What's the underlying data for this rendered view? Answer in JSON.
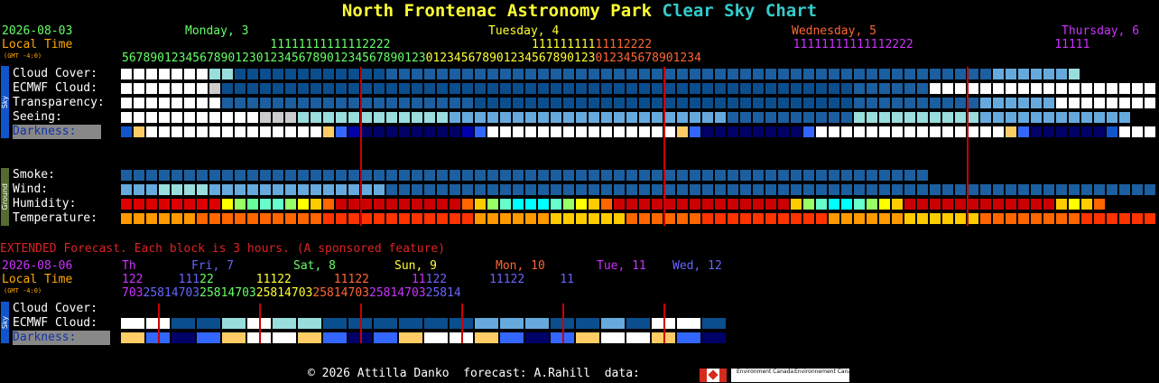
{
  "title": {
    "part1": "North Frontenac Astronomy Park",
    "part2": "Clear Sky Chart"
  },
  "header": {
    "date": "2026-08-03",
    "local_time": "Local Time",
    "gmt": "(GMT -4:0)",
    "days": [
      {
        "label": "Monday, 3",
        "color": "#66ff66"
      },
      {
        "label": "Tuesday, 4",
        "color": "#ffff33"
      },
      {
        "label": "Wednesday, 5",
        "color": "#ff6633"
      },
      {
        "label": "Thursday, 6",
        "color": "#cc33ff"
      }
    ],
    "hours_tens": "                     11111111111112222                    11111111111112222                    11111111111112222                    11111",
    "hours_ones": "5678901234567890123012345678901234567890123012345678901234567890123012345678901234"
  },
  "sky_section": {
    "side_label": "Sky",
    "rows": [
      {
        "label": "Cloud Cover:"
      },
      {
        "label": "ECMWF Cloud:"
      },
      {
        "label": "Transparency:"
      },
      {
        "label": "Seeing:"
      },
      {
        "label": "Darkness:"
      }
    ]
  },
  "ground_section": {
    "side_label": "Ground",
    "rows": [
      {
        "label": "Smoke:"
      },
      {
        "label": "Wind:"
      },
      {
        "label": "Humidity:"
      },
      {
        "label": "Temperature:"
      }
    ]
  },
  "extended": {
    "notice": "EXTENDED Forecast. Each block is 3 hours. (A sponsored feature)",
    "date": "2026-08-06",
    "local_time": "Local Time",
    "gmt": "(GMT -4:0)",
    "days": [
      {
        "label": "Th",
        "color": "#cc33ff"
      },
      {
        "label": "Fri, 7",
        "color": "#6666ff"
      },
      {
        "label": "Sat, 8",
        "color": "#66ff66"
      },
      {
        "label": "Sun, 9",
        "color": "#ffff33"
      },
      {
        "label": "Mon, 10",
        "color": "#ff6633"
      },
      {
        "label": "Tue, 11",
        "color": "#cc33ff"
      },
      {
        "label": "Wed, 12",
        "color": "#6666ff"
      }
    ],
    "hours_tens": "122     11122      11122      11122      11122      11122     11",
    "hours_ones": "703258147032581470325814703258147032581470325814",
    "side_label": "Sky",
    "rows": [
      {
        "label": "Cloud Cover:"
      },
      {
        "label": "ECMWF Cloud:"
      },
      {
        "label": "Darkness:"
      }
    ]
  },
  "footer": {
    "credit": "© 2026 Attilla Danko  forecast: A.Rahill  data:",
    "logo_text_1": "Environment Canada",
    "logo_text_2": "Environnement Canada"
  },
  "colors": {
    "clear": "#ffffff",
    "cloud_light": "#99dddd",
    "cloud_mid": "#66aadd",
    "cloud_dark": "#0b4e8e",
    "overcast": "#1b5fa0",
    "gray": "#cccccc",
    "sky_bar": "#1155cc",
    "ground_bar": "#556b2f",
    "vline": "#cc0000"
  }
}
